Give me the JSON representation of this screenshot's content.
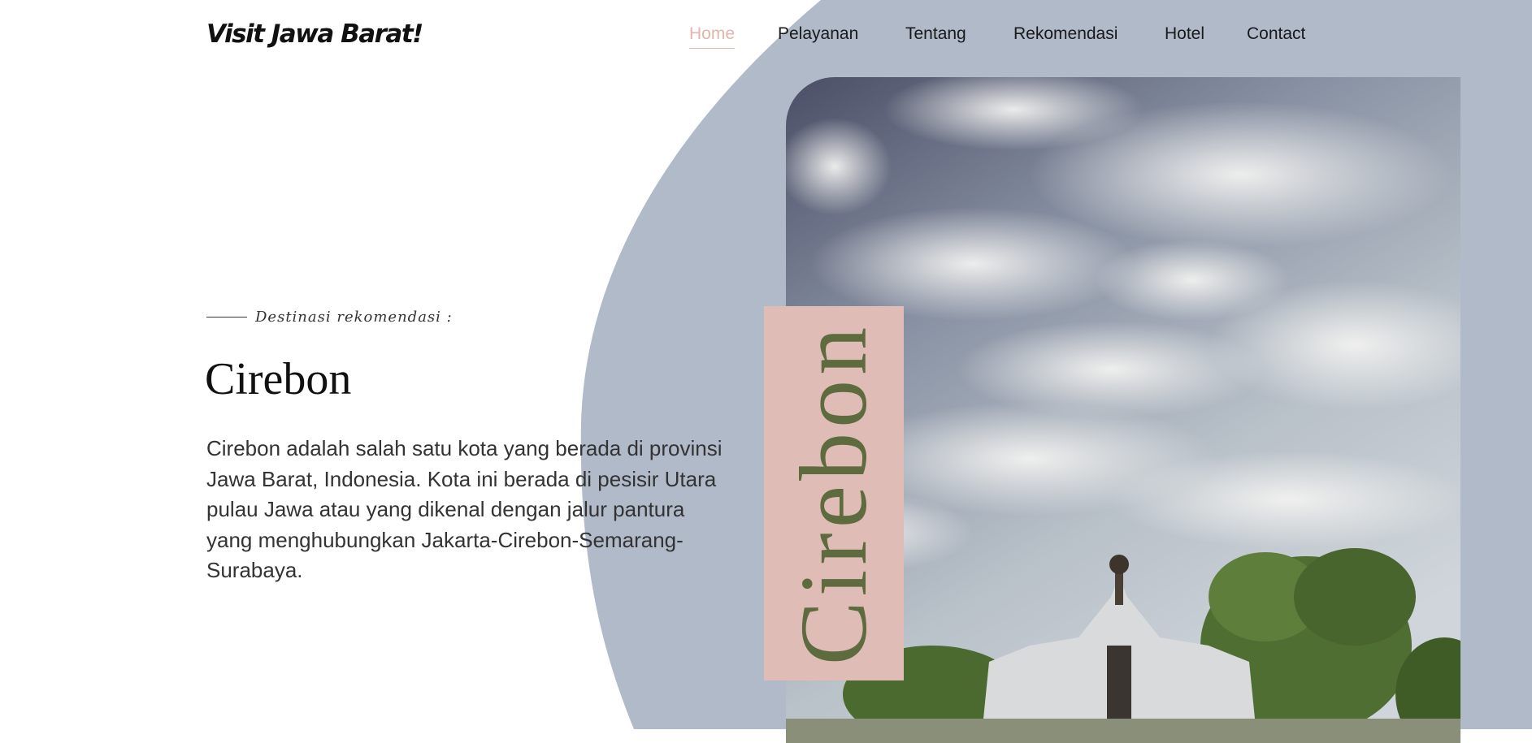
{
  "brand": {
    "logo_text": "Visit Jawa Barat!"
  },
  "nav": {
    "items": [
      {
        "label": "Home",
        "active": true
      },
      {
        "label": "Pelayanan",
        "active": false
      },
      {
        "label": "Tentang",
        "active": false
      },
      {
        "label": "Rekomendasi",
        "active": false
      },
      {
        "label": "Hotel",
        "active": false
      },
      {
        "label": "Contact",
        "active": false
      }
    ]
  },
  "hero": {
    "eyebrow": "Destinasi rekomendasi :",
    "title": "Cirebon",
    "description": "Cirebon adalah salah satu kota yang berada di provinsi Jawa Barat, Indonesia. Kota ini berada di pesisir Utara pulau Jawa atau yang dikenal dengan jalur pantura yang menghubungkan Jakarta-Cirebon-Semarang-Surabaya.",
    "vertical_label": "Cirebon"
  },
  "colors": {
    "accent": "#e3b5ad",
    "arc_background": "#b0bac9",
    "card_background": "#dfbcb6",
    "text_dark": "#111111"
  }
}
